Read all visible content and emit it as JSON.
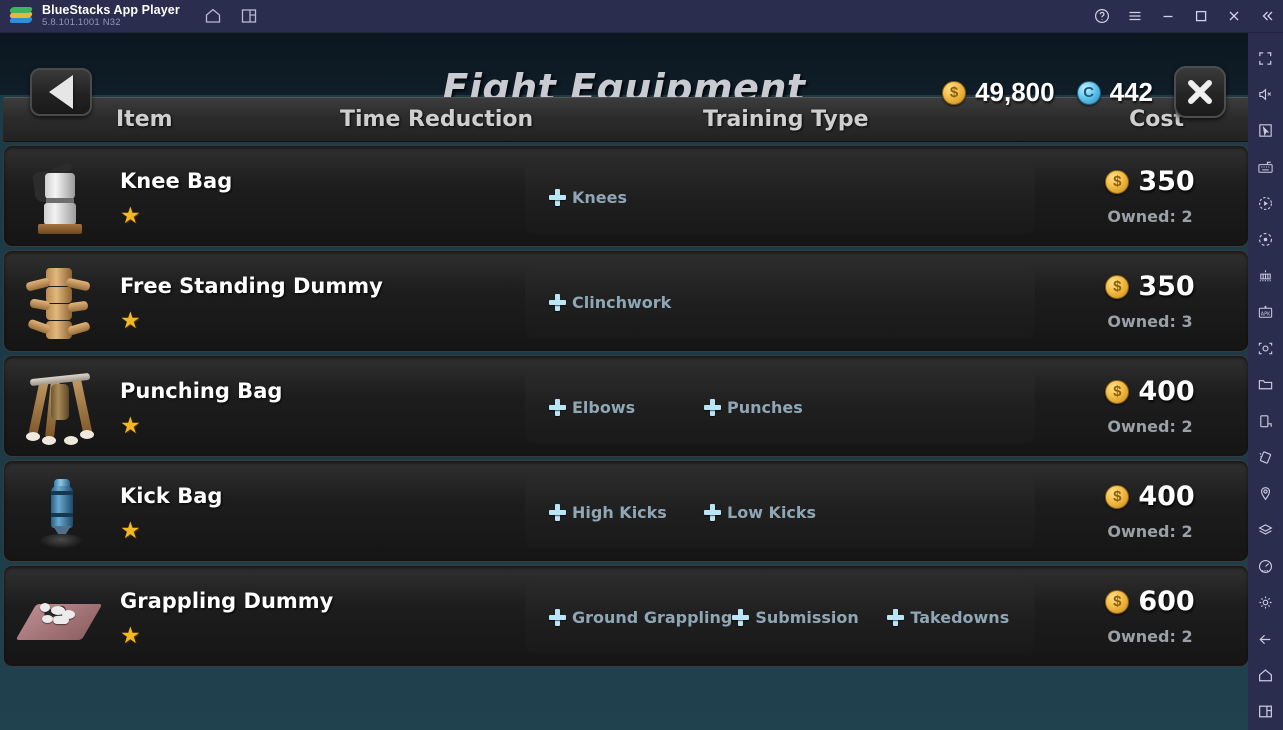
{
  "bluestacks": {
    "app_name": "BlueStacks App Player",
    "version": "5.8.101.1001  N32",
    "titlebar_icons": [
      "home-icon",
      "multi-instance-icon"
    ],
    "window_controls": [
      "help-icon",
      "menu-icon",
      "minimize-icon",
      "maximize-icon",
      "close-icon",
      "collapse-icon"
    ],
    "sidebar_icons": [
      "fullscreen-icon",
      "mute-icon",
      "cursor-icon",
      "keyboard-controls-icon",
      "macro-play-icon",
      "record-icon",
      "game-controls-icon",
      "install-apk-icon",
      "screenshot-icon",
      "media-folder-icon",
      "rotate-icon",
      "shake-icon",
      "location-icon",
      "layers-icon",
      "performance-icon"
    ],
    "sidebar_bottom_icons": [
      "settings-icon",
      "back-icon",
      "home-icon",
      "recent-apps-icon"
    ]
  },
  "game": {
    "title": "Fight Equipment",
    "back_button_label": "Back",
    "close_button_label": "Close",
    "currency": {
      "gold": {
        "icon": "gold-coin-icon",
        "glyph": "$",
        "value": "49,800"
      },
      "gem": {
        "icon": "blue-token-icon",
        "glyph": "C",
        "value": "442"
      }
    },
    "columns": {
      "item": "Item",
      "time_reduction": "Time Reduction",
      "training_type": "Training Type",
      "cost": "Cost"
    },
    "rows": [
      {
        "icon": "knee-bag-icon",
        "name": "Knee Bag",
        "stars": 1,
        "star_glyph": "★",
        "time_reduction": "",
        "training_types": [
          "Knees"
        ],
        "cost": "350",
        "owned": "Owned: 2"
      },
      {
        "icon": "free-standing-dummy-icon",
        "name": "Free Standing Dummy",
        "stars": 1,
        "star_glyph": "★",
        "time_reduction": "",
        "training_types": [
          "Clinchwork"
        ],
        "cost": "350",
        "owned": "Owned: 3"
      },
      {
        "icon": "punching-bag-icon",
        "name": "Punching Bag",
        "stars": 1,
        "star_glyph": "★",
        "time_reduction": "",
        "training_types": [
          "Elbows",
          "Punches"
        ],
        "cost": "400",
        "owned": "Owned: 2"
      },
      {
        "icon": "kick-bag-icon",
        "name": "Kick Bag",
        "stars": 1,
        "star_glyph": "★",
        "time_reduction": "",
        "training_types": [
          "High Kicks",
          "Low Kicks"
        ],
        "cost": "400",
        "owned": "Owned: 2"
      },
      {
        "icon": "grappling-dummy-icon",
        "name": "Grappling Dummy",
        "stars": 1,
        "star_glyph": "★",
        "time_reduction": "",
        "training_types": [
          "Ground Grappling",
          "Submission",
          "Takedowns"
        ],
        "cost": "600",
        "owned": "Owned: 2"
      }
    ]
  },
  "colors": {
    "titlebar": "#2b2d4f",
    "game_bg": "#1e3c48",
    "header_bg": "#0c1720",
    "row_bg": "#1d1d1d",
    "accent_gold": "#f2b824",
    "tag_blue": "#b9e5f7",
    "tag_text": "#8fa6b5"
  }
}
